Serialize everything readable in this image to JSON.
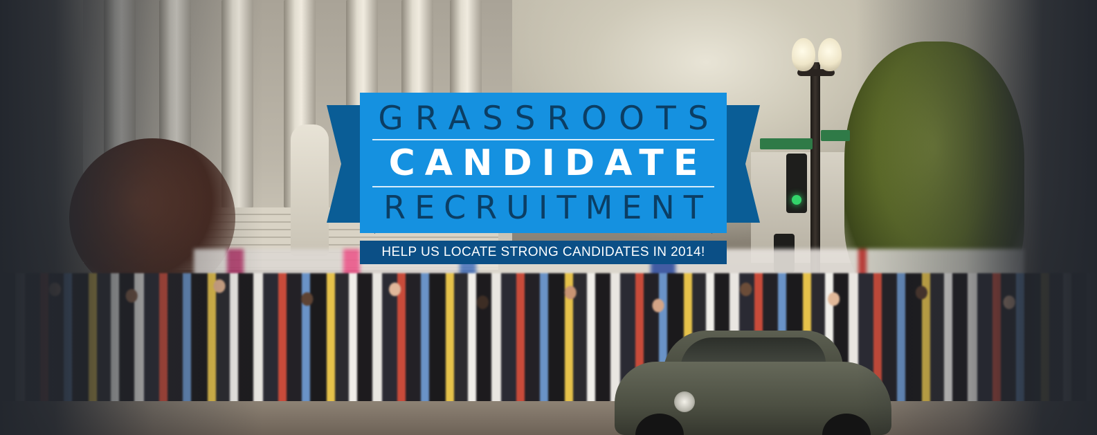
{
  "hero": {
    "title_line_1": "GRASSROOTS",
    "title_line_2": "CANDIDATE",
    "title_line_3": "RECRUITMENT",
    "tagline": "HELP US LOCATE STRONG CANDIDATES IN 2014!"
  },
  "colors": {
    "badge_blue": "#1591e0",
    "ribbon_dark_blue": "#0a5d96",
    "title_text_dark": "#0b3e64",
    "title_text_light": "#ffffff",
    "tagline_background": "#0b4f86",
    "page_background": "#23272e"
  }
}
